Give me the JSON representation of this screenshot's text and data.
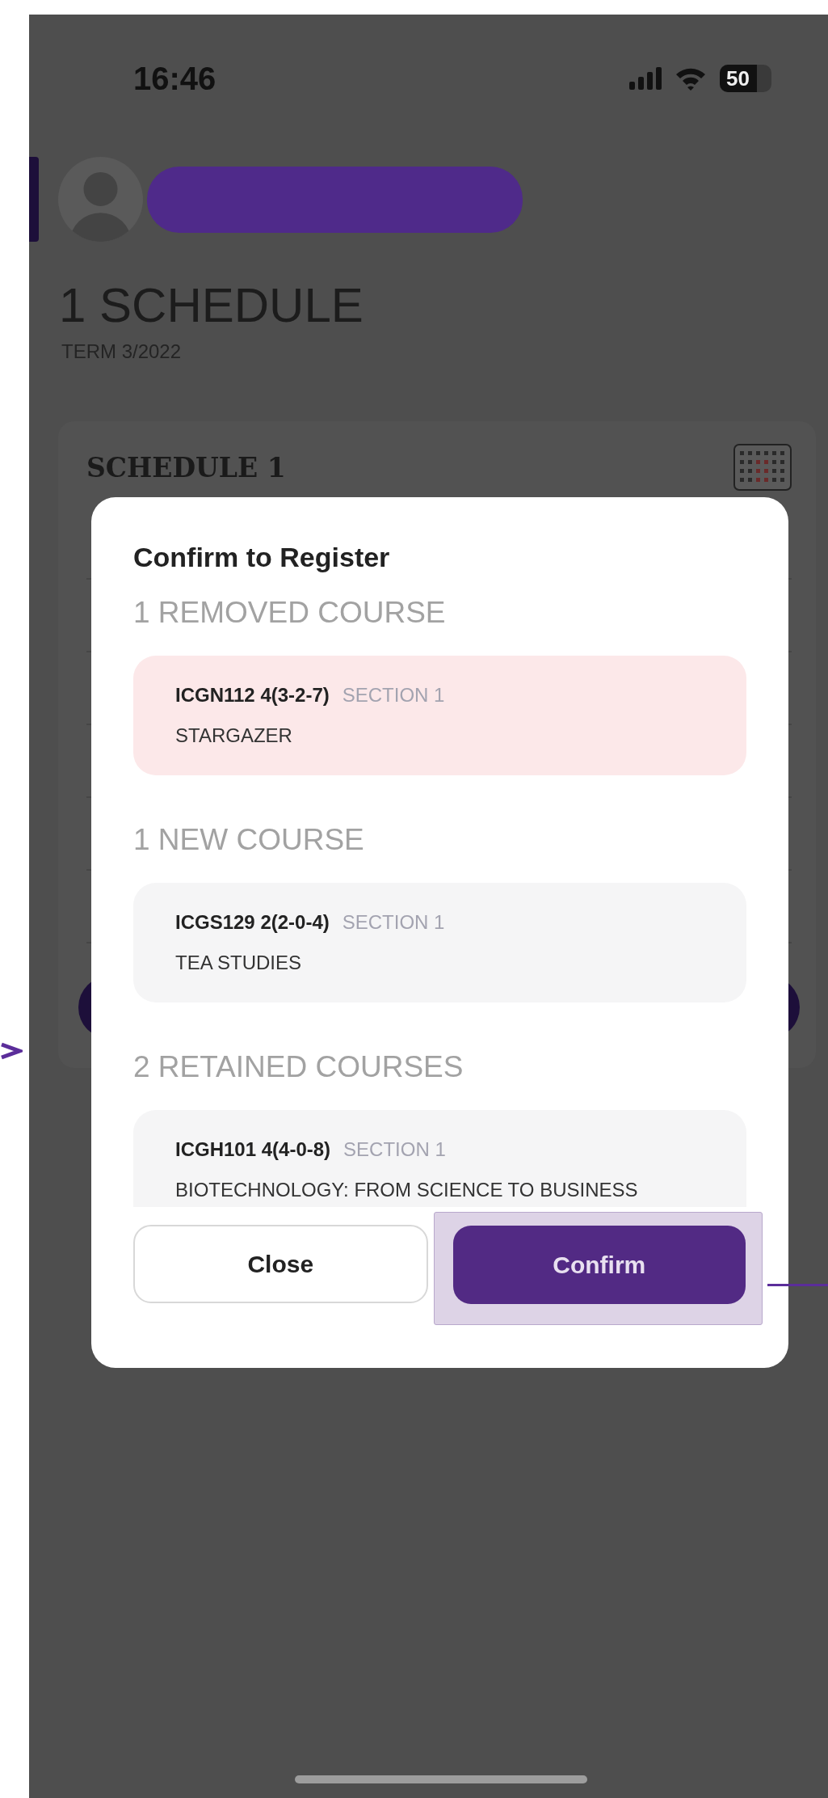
{
  "status_bar": {
    "time": "16:46",
    "battery": "50"
  },
  "header": {
    "title": "1 SCHEDULE",
    "subtitle": "TERM 3/2022"
  },
  "schedule_card": {
    "title": "SCHEDULE 1"
  },
  "dialog": {
    "title": "Confirm to Register",
    "sections": [
      {
        "heading": "1 REMOVED COURSE",
        "kind": "removed",
        "courses": [
          {
            "code": "ICGN112 4(3-2-7)",
            "section": "SECTION 1",
            "name": "STARGAZER"
          }
        ]
      },
      {
        "heading": "1 NEW COURSE",
        "kind": "new",
        "courses": [
          {
            "code": "ICGS129 2(2-0-4)",
            "section": "SECTION 1",
            "name": "TEA STUDIES"
          }
        ]
      },
      {
        "heading": "2 RETAINED COURSES",
        "kind": "retained",
        "courses": [
          {
            "code": "ICGH101 4(4-0-8)",
            "section": "SECTION 1",
            "name": "BIOTECHNOLOGY: FROM SCIENCE TO BUSINESS"
          }
        ]
      }
    ],
    "buttons": [
      {
        "label": "Close",
        "kind": "secondary",
        "highlighted": false
      },
      {
        "label": "Confirm",
        "kind": "primary",
        "highlighted": true
      }
    ]
  }
}
